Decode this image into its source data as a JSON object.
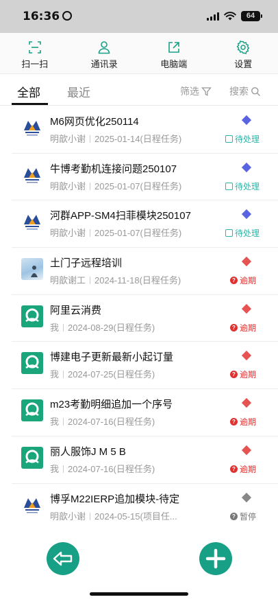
{
  "status_bar": {
    "time": "16:36",
    "battery": "64"
  },
  "toolbar": {
    "items": [
      {
        "label": "扫一扫",
        "icon": "scan-icon"
      },
      {
        "label": "通讯录",
        "icon": "contacts-icon"
      },
      {
        "label": "电脑端",
        "icon": "external-link-icon"
      },
      {
        "label": "设置",
        "icon": "gear-icon"
      }
    ]
  },
  "tabs": {
    "all": "全部",
    "recent": "最近",
    "filter": "筛选",
    "search": "搜索"
  },
  "colors": {
    "accent": "#17a085",
    "pending": "#2bb5a8",
    "overdue": "#e03131",
    "diamond_blue": "#5a63e0",
    "diamond_red": "#e65353",
    "diamond_gray": "#888888"
  },
  "tasks": [
    {
      "title": "M6网页优化250114",
      "owner": "明歆小谢",
      "date": "2025-01-14",
      "type": "(日程任务)",
      "status": "待处理"
    },
    {
      "title": "牛博考勤机连接问题250107",
      "owner": "明歆小谢",
      "date": "2025-01-07",
      "type": "(日程任务)",
      "status": "待处理"
    },
    {
      "title": "河群APP-SM4扫菲模块250107",
      "owner": "明歆小谢",
      "date": "2025-01-07",
      "type": "(日程任务)",
      "status": "待处理"
    },
    {
      "title": "土门子远程培训",
      "owner": "明歆谢工",
      "date": "2024-11-18",
      "type": "(日程任务)",
      "status": "逾期"
    },
    {
      "title": "阿里云消费",
      "owner": "我",
      "date": "2024-08-29",
      "type": "(日程任务)",
      "status": "逾期"
    },
    {
      "title": "博建电子更新最新小起订量",
      "owner": "我",
      "date": "2024-07-25",
      "type": "(日程任务)",
      "status": "逾期"
    },
    {
      "title": "m23考勤明细追加一个序号",
      "owner": "我",
      "date": "2024-07-16",
      "type": "(日程任务)",
      "status": "逾期"
    },
    {
      "title": "丽人服饰J M 5 B",
      "owner": "我",
      "date": "2024-07-16",
      "type": "(日程任务)",
      "status": "逾期"
    },
    {
      "title": "博孚M22IERP追加模块-待定",
      "owner": "明歆小谢",
      "date": "2024-05-15",
      "type": "(项目任...",
      "status": "暂停"
    }
  ]
}
